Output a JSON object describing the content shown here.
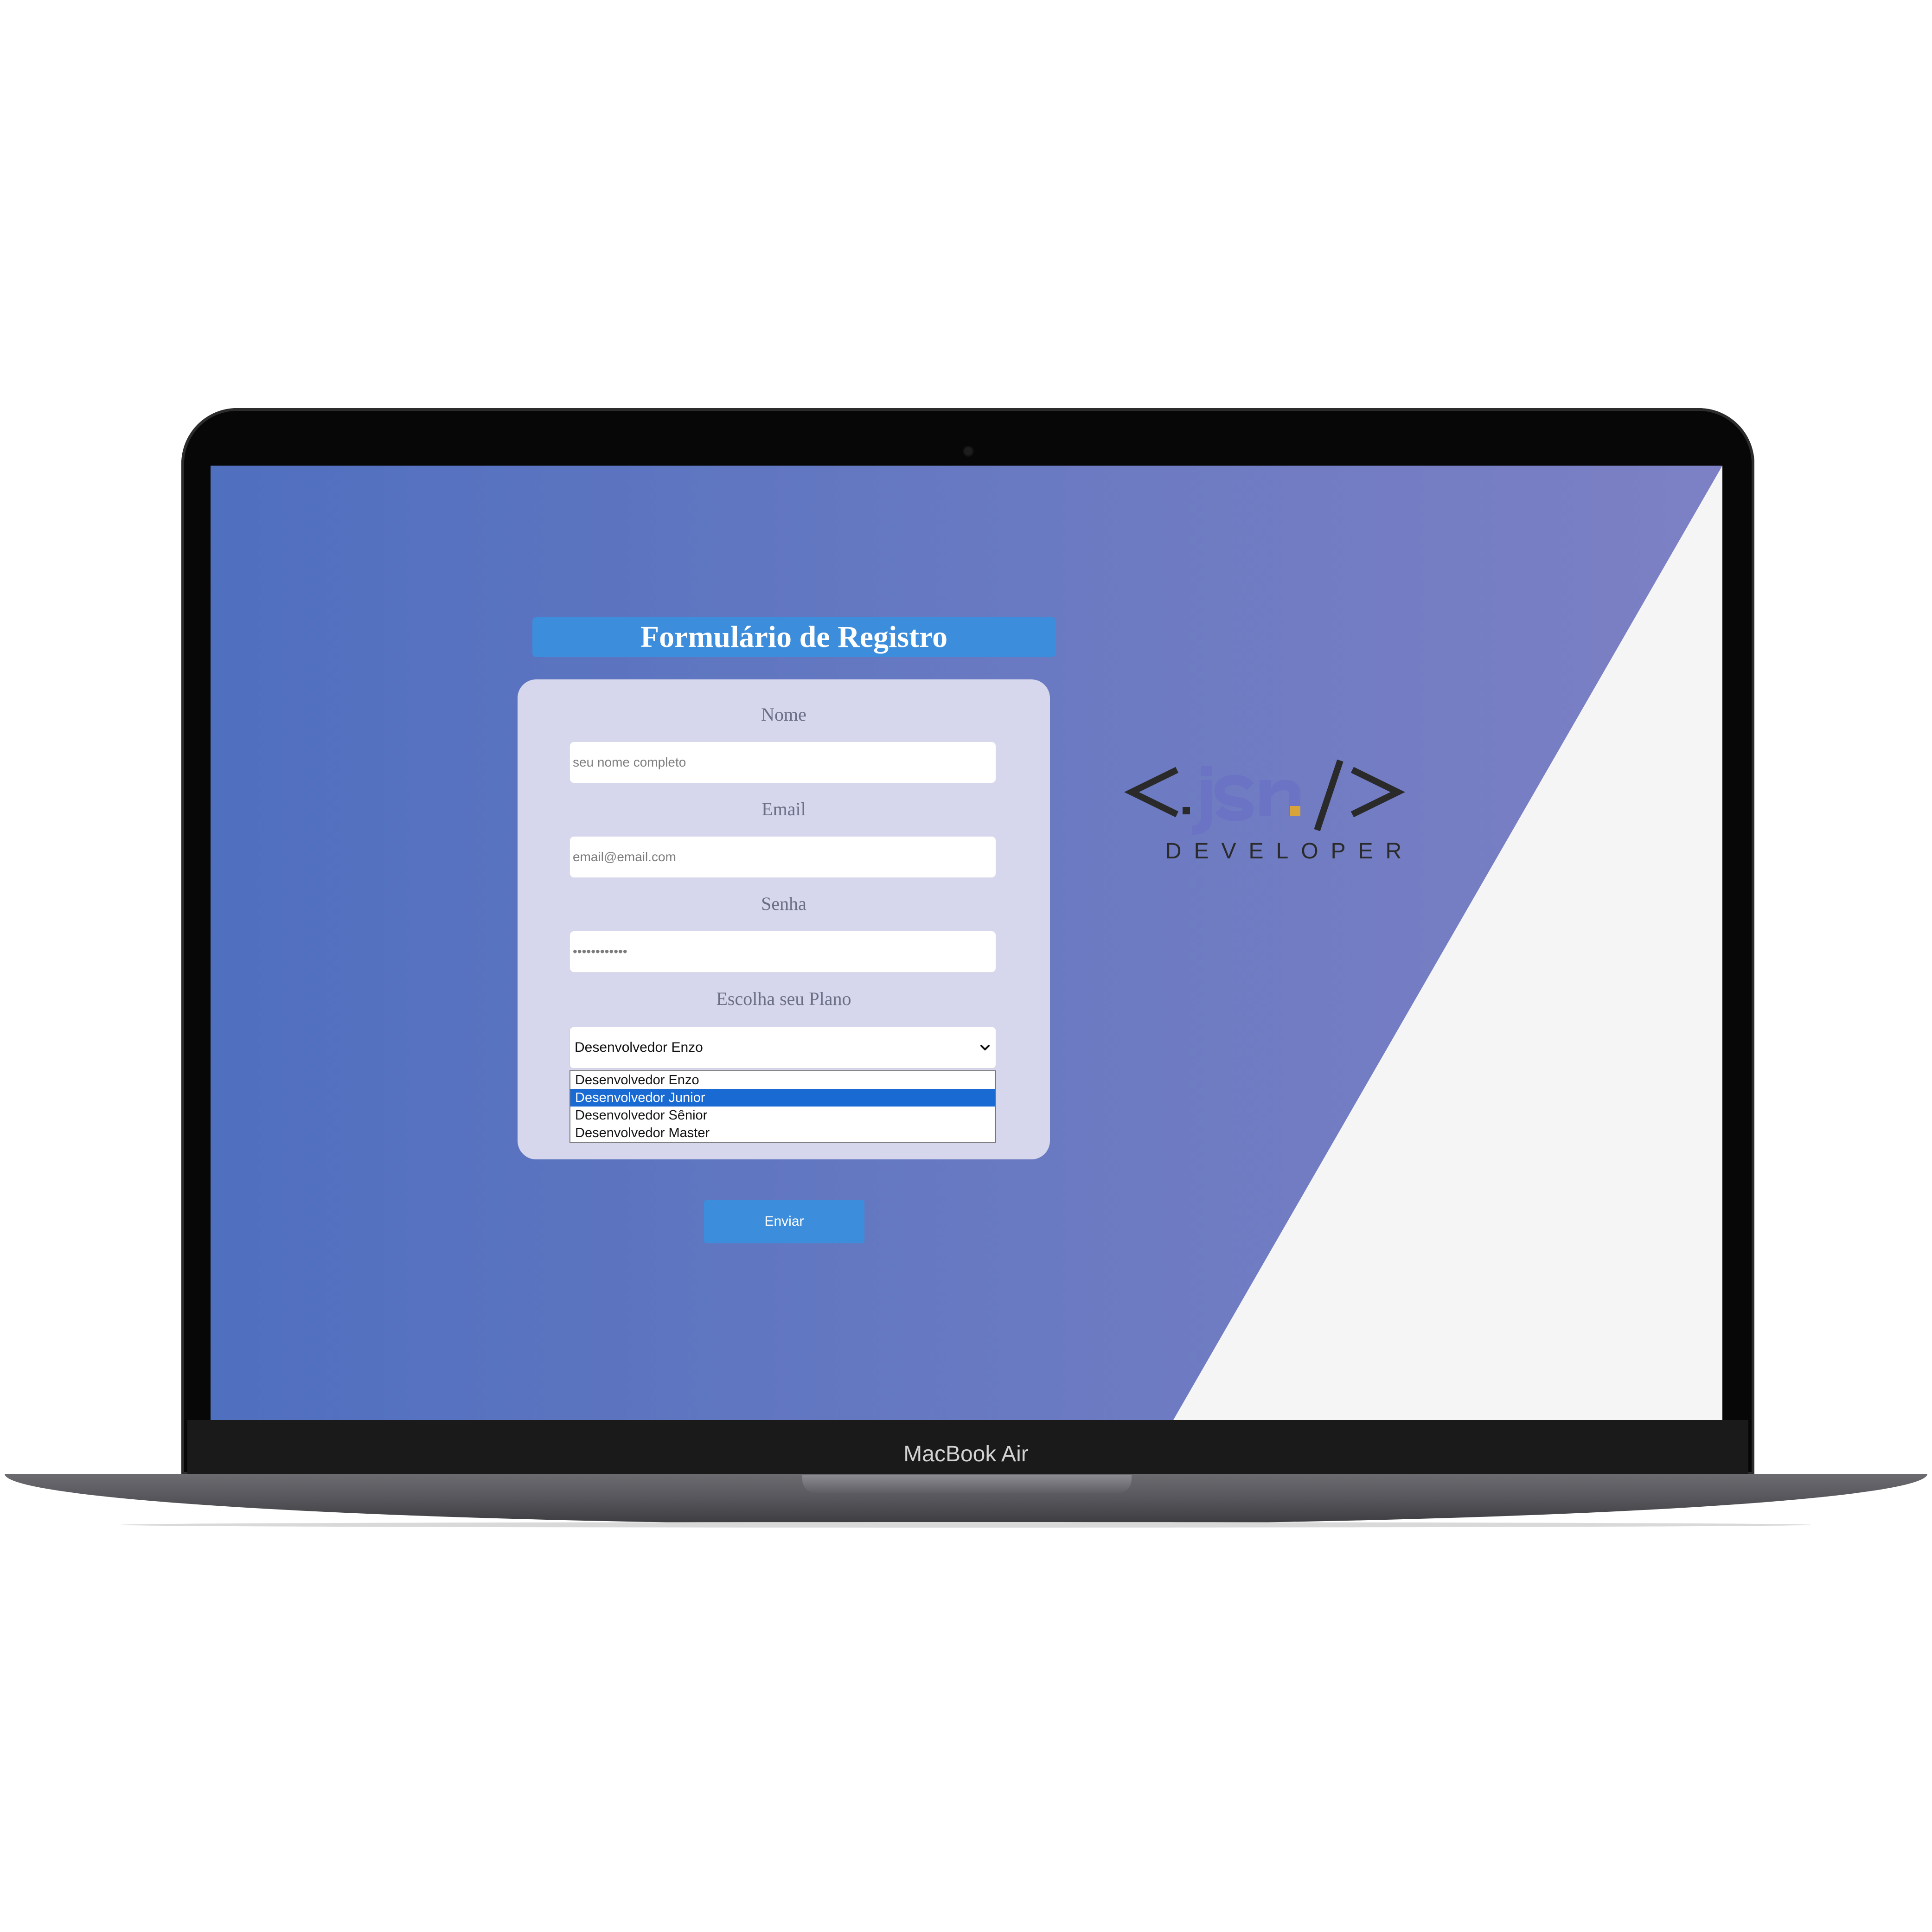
{
  "device": {
    "model_label": "MacBook Air"
  },
  "form": {
    "title": "Formulário de Registro",
    "fields": [
      {
        "label": "Nome",
        "placeholder": "seu nome completo",
        "type": "text"
      },
      {
        "label": "Email",
        "placeholder": "email@email.com",
        "type": "email"
      },
      {
        "label": "Senha",
        "placeholder": "••••••••••••",
        "type": "password"
      }
    ],
    "plan": {
      "label": "Escolha seu Plano",
      "selected": "Desenvolvedor Enzo",
      "options": [
        "Desenvolvedor Enzo",
        "Desenvolvedor Junior",
        "Desenvolvedor Sênior",
        "Desenvolvedor Master"
      ],
      "highlighted_index": 1
    },
    "submit_label": "Enviar"
  },
  "logo": {
    "text": "<.jsn/>",
    "subtitle": "DEVELOPER"
  },
  "colors": {
    "accent": "#3c8ddb",
    "card": "#d6d6ec",
    "highlight": "#1a6ad4",
    "logo_blue": "#6a73c4",
    "logo_gold": "#d8a43a"
  }
}
